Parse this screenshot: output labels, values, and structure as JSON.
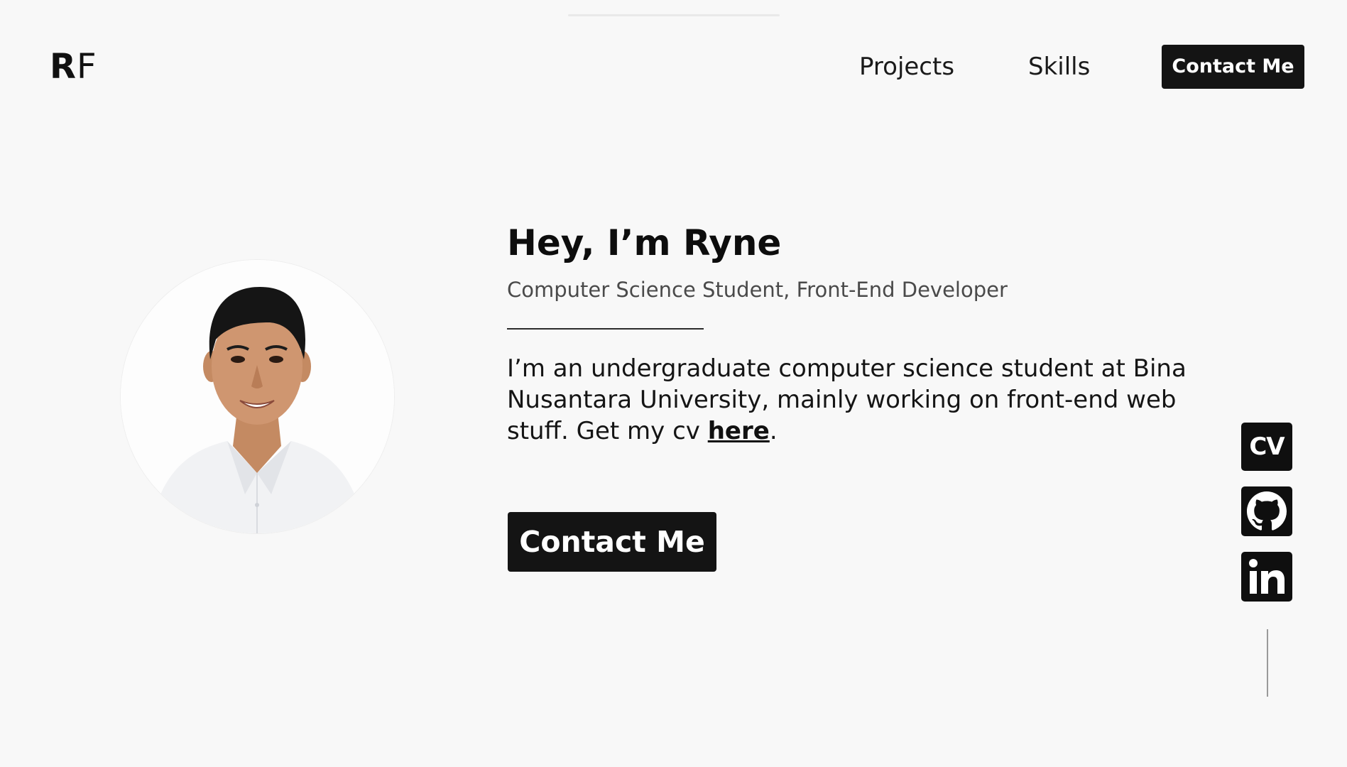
{
  "header": {
    "logo": {
      "first": "R",
      "second": "F"
    },
    "nav": [
      {
        "label": "Projects"
      },
      {
        "label": "Skills"
      }
    ],
    "contact_label": "Contact Me"
  },
  "hero": {
    "title": "Hey, I’m Ryne",
    "subtitle": "Computer Science Student, Front-End Developer",
    "bio_text": "I’m an undergraduate computer science student at Bina Nusantara University, mainly working on front-end web stuff. Get my cv ",
    "bio_link": "here",
    "bio_end": ".",
    "contact_label": "Contact Me"
  },
  "social": {
    "cv_label": "CV",
    "items": [
      {
        "icon": "github-icon"
      },
      {
        "icon": "linkedin-icon"
      }
    ]
  },
  "colors": {
    "background": "#f8f8f8",
    "button": "#141414",
    "text": "#111111"
  }
}
